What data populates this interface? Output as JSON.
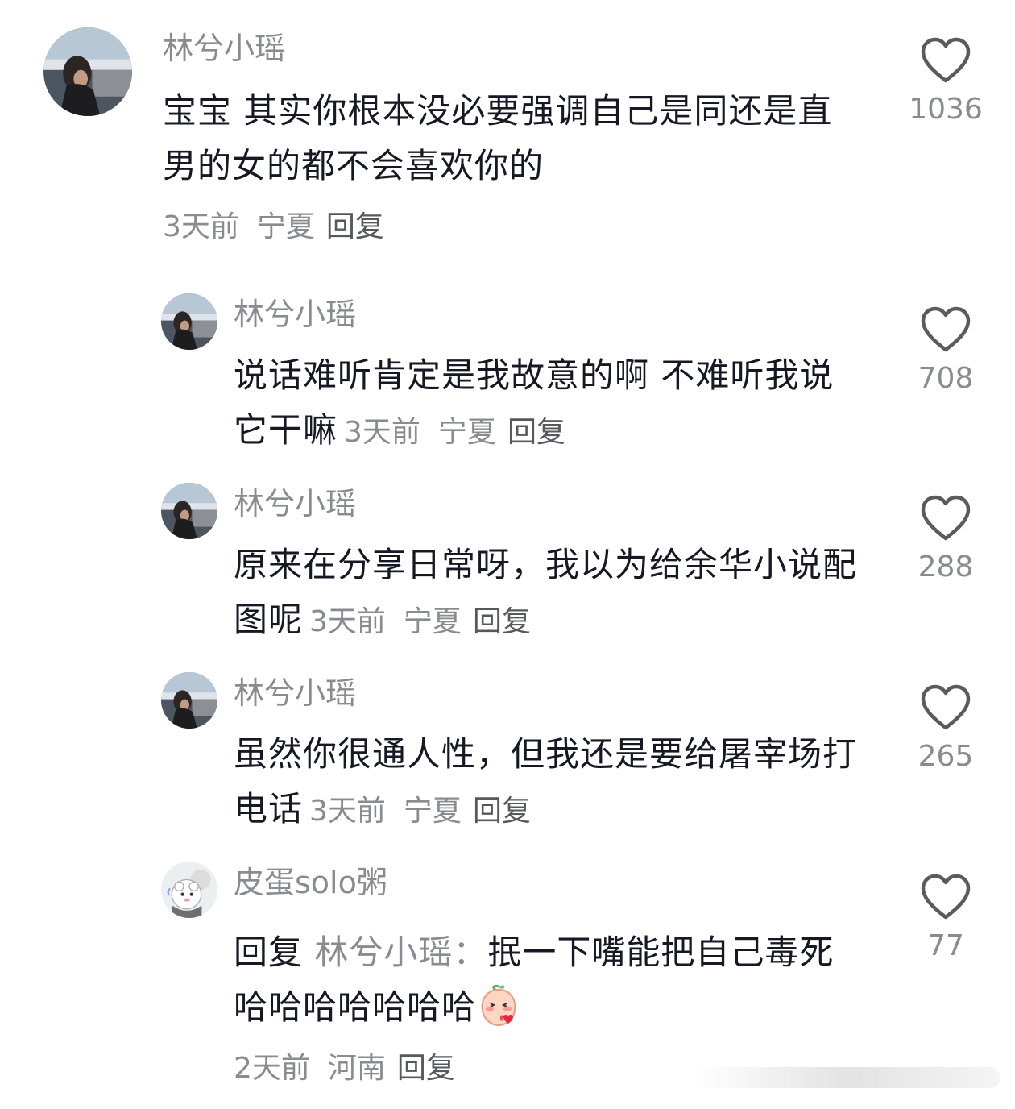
{
  "comments": [
    {
      "username": "林兮小瑶",
      "text": "宝宝 其实你根本没必要强调自己是同还是直 男的女的都不会喜欢你的",
      "time": "3天前",
      "location": "宁夏",
      "reply_label": "回复",
      "likes": "1036"
    },
    {
      "username": "林兮小瑶",
      "text": "说话难听肯定是我故意的啊 不难听我说它干嘛",
      "time": "3天前",
      "location": "宁夏",
      "reply_label": "回复",
      "likes": "708"
    },
    {
      "username": "林兮小瑶",
      "text": "原来在分享日常呀，我以为给余华小说配图呢",
      "time": "3天前",
      "location": "宁夏",
      "reply_label": "回复",
      "likes": "288"
    },
    {
      "username": "林兮小瑶",
      "text": "虽然你很通人性，但我还是要给屠宰场打电话",
      "time": "3天前",
      "location": "宁夏",
      "reply_label": "回复",
      "likes": "265"
    },
    {
      "username": "皮蛋solo粥",
      "reply_prefix": "回复",
      "mention": "林兮小瑶：",
      "text": "抿一下嘴能把自己毒死哈哈哈哈哈哈哈",
      "time": "2天前",
      "location": "河南",
      "reply_label": "回复",
      "likes": "77"
    }
  ],
  "icons": {
    "like": "heart-outline-icon",
    "emoji": "blushing-peach-emoji"
  },
  "colors": {
    "text": "#161823",
    "secondary": "#8a8b91",
    "reply_link": "#57585e"
  }
}
